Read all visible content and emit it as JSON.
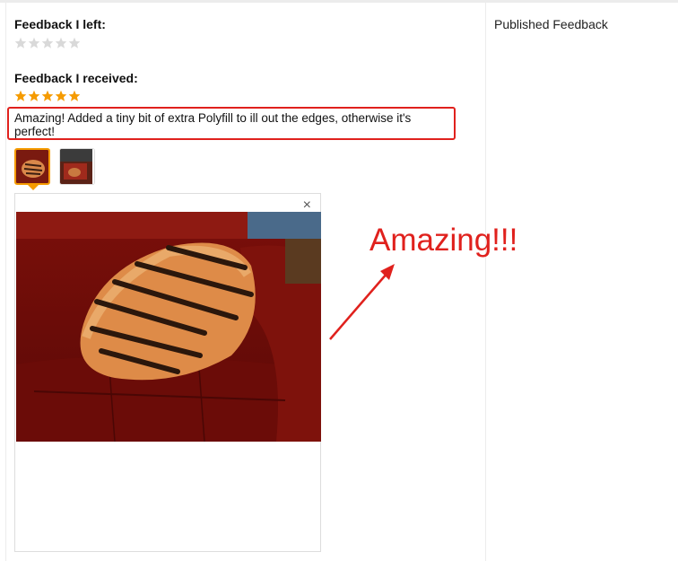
{
  "feedback_left": {
    "label": "Feedback I left:",
    "rating": 0
  },
  "feedback_received": {
    "label": "Feedback I received:",
    "rating": 5,
    "text": "Amazing! Added a tiny bit of extra Polyfill to ill out the edges, otherwise it's perfect!"
  },
  "sidebar": {
    "title": "Published Feedback"
  },
  "viewer": {
    "close_label": "×"
  },
  "annotation": {
    "text": "Amazing!!!"
  },
  "colors": {
    "star_on": "#f59b00",
    "star_off": "#d9d9d9",
    "highlight": "#e0211d"
  }
}
